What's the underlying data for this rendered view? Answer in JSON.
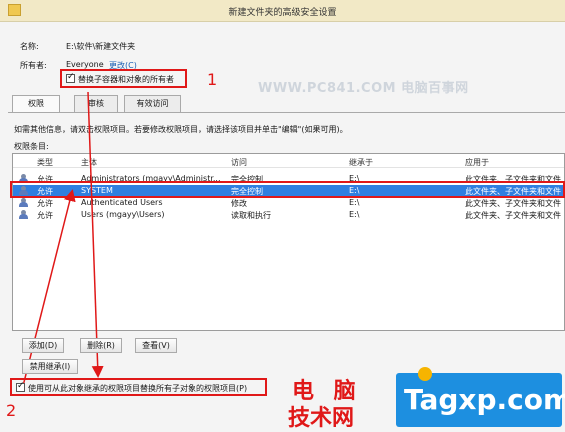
{
  "window": {
    "title": "新建文件夹的高级安全设置"
  },
  "info": {
    "name_label": "名称:",
    "name_value": "E:\\软件\\新建文件夹",
    "owner_label": "所有者:",
    "owner_value": "Everyone",
    "owner_change_link": "更改(C)",
    "replace_owner_checkbox": "替换子容器和对象的所有者"
  },
  "tabs": [
    {
      "label": "权限"
    },
    {
      "label": "审核"
    },
    {
      "label": "有效访问"
    }
  ],
  "description": "如需其他信息，请双击权限项目。若要修改权限项目，请选择该项目并单击\"编辑\"(如果可用)。",
  "entries_label": "权限条目:",
  "columns": {
    "type": "类型",
    "principal": "主体",
    "access": "访问",
    "inherited_from": "继承于",
    "applies_to": "应用于"
  },
  "rows": [
    {
      "type": "允许",
      "principal": "Administrators (mgayy\\Administr...",
      "access": "完全控制",
      "inherited_from": "E:\\",
      "applies_to": "此文件夹、子文件夹和文件"
    },
    {
      "type": "允许",
      "principal": "SYSTEM",
      "access": "完全控制",
      "inherited_from": "E:\\",
      "applies_to": "此文件夹、子文件夹和文件"
    },
    {
      "type": "允许",
      "principal": "Authenticated Users",
      "access": "修改",
      "inherited_from": "E:\\",
      "applies_to": "此文件夹、子文件夹和文件"
    },
    {
      "type": "允许",
      "principal": "Users (mgayy\\Users)",
      "access": "读取和执行",
      "inherited_from": "E:\\",
      "applies_to": "此文件夹、子文件夹和文件"
    }
  ],
  "buttons": {
    "add": "添加(D)",
    "remove": "删除(R)",
    "view": "查看(V)",
    "disable_inheritance": "禁用继承(I)"
  },
  "bottom_checkbox": "使用可从此对象继承的权限项目替换所有子对象的权限项目(P)",
  "annotations": {
    "num1": "1",
    "num2": "2"
  },
  "watermarks": {
    "top": "WWW.PC841.COM 电脑百事网",
    "brand_cn_line1": "电 脑",
    "brand_cn_line2": "技术网",
    "brand_en": "Tagxp.com"
  },
  "colors": {
    "selection": "#2f7fe0",
    "annotation_red": "#e01818",
    "titlebar": "#f2e9c6"
  }
}
